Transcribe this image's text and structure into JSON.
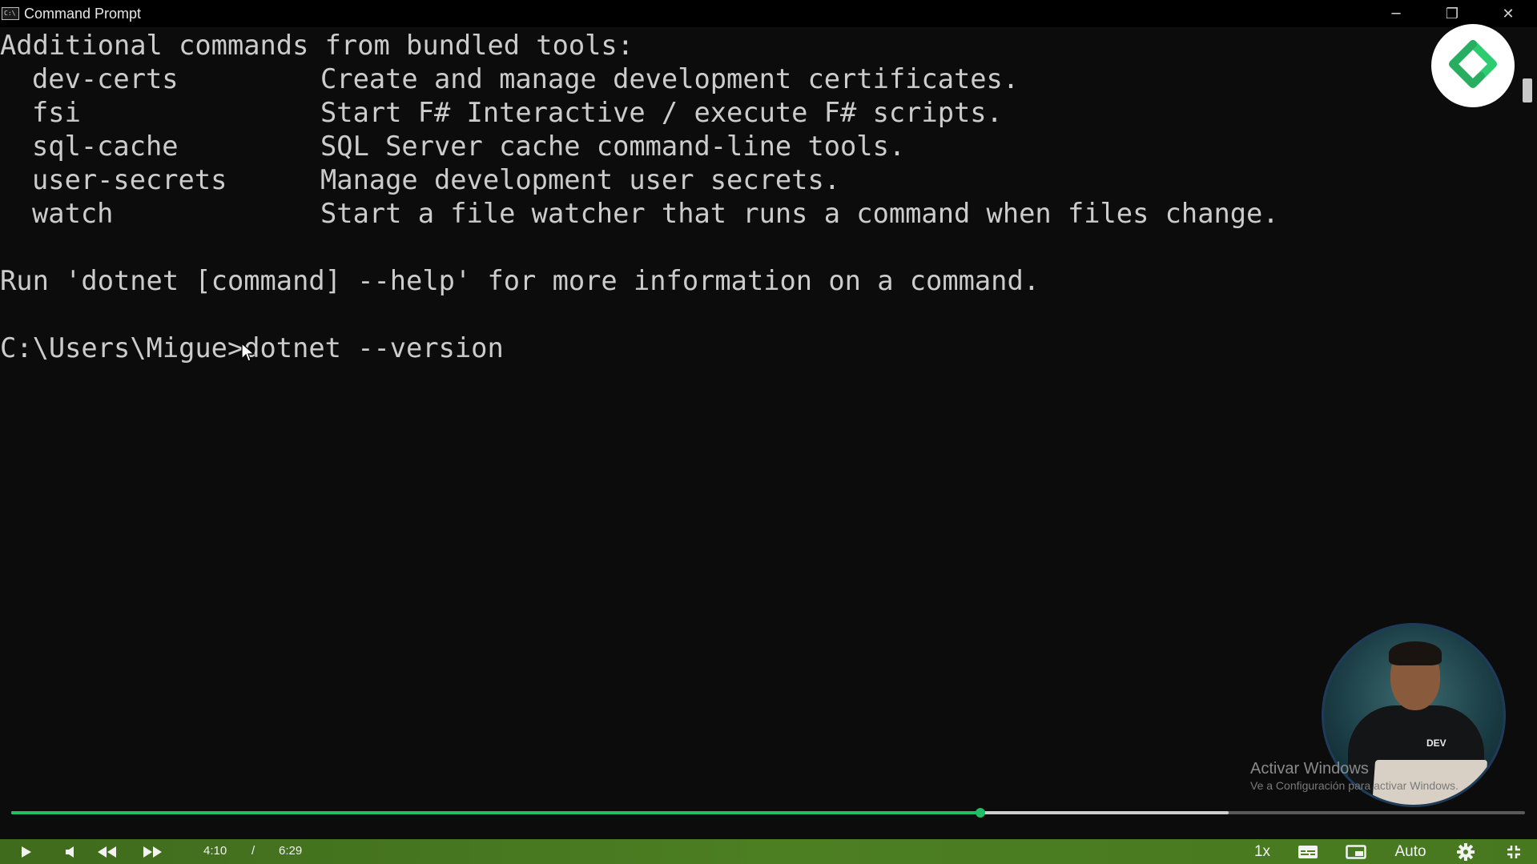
{
  "window": {
    "title": "Command Prompt",
    "app_icon_text": "C:\\",
    "minimize_glyph": "─",
    "restore_glyph": "❐",
    "close_glyph": "✕"
  },
  "terminal": {
    "heading": "Additional commands from bundled tools:",
    "commands": [
      {
        "name": "dev-certs",
        "description": "Create and manage development certificates."
      },
      {
        "name": "fsi",
        "description": "Start F# Interactive / execute F# scripts."
      },
      {
        "name": "sql-cache",
        "description": "SQL Server cache command-line tools."
      },
      {
        "name": "user-secrets",
        "description": "Manage development user secrets."
      },
      {
        "name": "watch",
        "description": "Start a file watcher that runs a command when files change."
      }
    ],
    "help_hint": "Run 'dotnet [command] --help' for more information on a command.",
    "prompt": "C:\\Users\\Migue>",
    "current_input": "dotnet --version"
  },
  "overlay": {
    "logo_icon": "green-diamond-logo-icon",
    "watermark_title": "Activar Windows",
    "watermark_subtitle": "Ve a Configuración para activar Windows.",
    "presenter_shirt_text": "DEV"
  },
  "player": {
    "current_time": "4:10",
    "time_separator": "/",
    "duration": "6:29",
    "played_fraction": 0.64,
    "buffered_fraction": 0.804,
    "speed_label": "1x",
    "quality_label": "Auto",
    "accent_color": "#1fbf66",
    "bar_color": "#4c7e22"
  }
}
